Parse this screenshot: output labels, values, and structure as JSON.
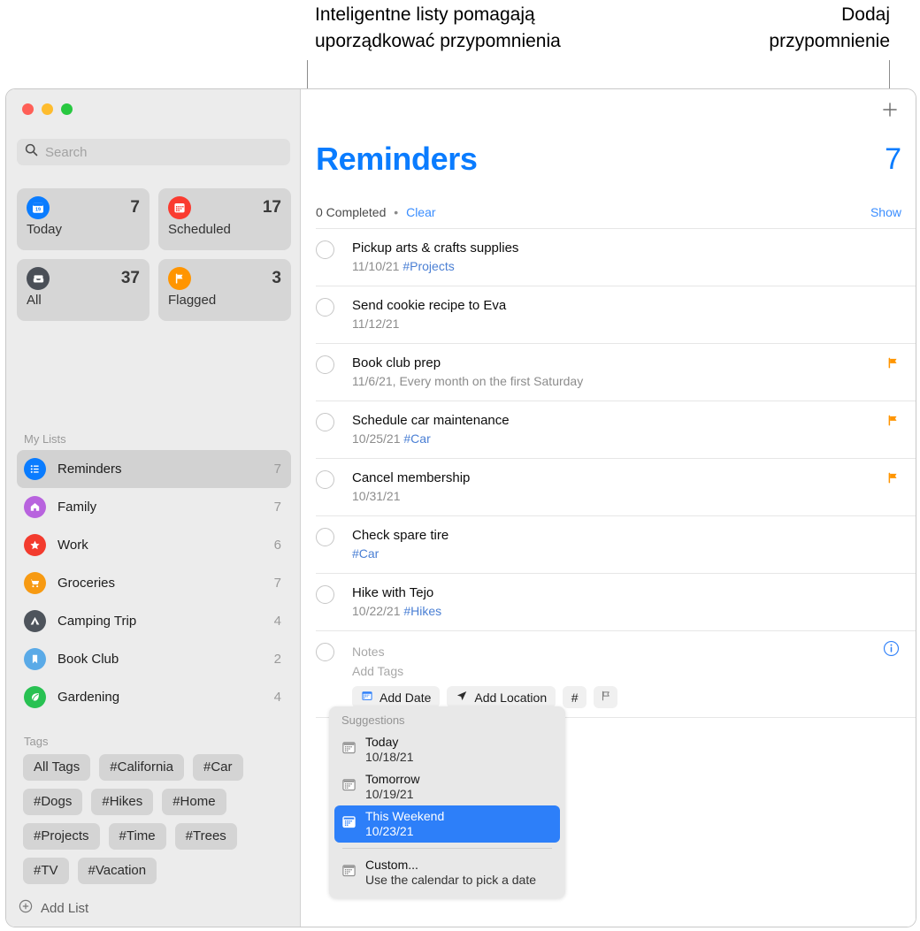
{
  "annotations": {
    "left_callout": "Inteligentne listy pomagają\nuporządkować przypomnienia",
    "right_callout": "Dodaj\nprzypomnienie"
  },
  "window": {
    "traffic_lights": [
      {
        "name": "close",
        "color": "#FF5F57"
      },
      {
        "name": "minimize",
        "color": "#FEBC2E"
      },
      {
        "name": "zoom",
        "color": "#28C840"
      }
    ]
  },
  "sidebar": {
    "search": {
      "placeholder": "Search",
      "icon": "search-icon"
    },
    "smart_lists": [
      {
        "label": "Today",
        "count": "7",
        "icon": "calendar-today-icon",
        "color": "#0a7cff",
        "day": "19"
      },
      {
        "label": "Scheduled",
        "count": "17",
        "icon": "calendar-scheduled-icon",
        "color": "#fa3b30"
      },
      {
        "label": "All",
        "count": "37",
        "icon": "inbox-tray-icon",
        "color": "#4a4f57"
      },
      {
        "label": "Flagged",
        "count": "3",
        "icon": "flag-icon",
        "color": "#ff9500"
      }
    ],
    "my_lists_header": "My Lists",
    "lists": [
      {
        "label": "Reminders",
        "count": "7",
        "icon": "bulleted-list-icon",
        "color": "#0a7cff",
        "selected": true
      },
      {
        "label": "Family",
        "count": "7",
        "icon": "house-icon",
        "color": "#b863de",
        "selected": false
      },
      {
        "label": "Work",
        "count": "6",
        "icon": "star-icon",
        "color": "#f33b2e",
        "selected": false
      },
      {
        "label": "Groceries",
        "count": "7",
        "icon": "shopping-cart-icon",
        "color": "#f79a12",
        "selected": false
      },
      {
        "label": "Camping Trip",
        "count": "4",
        "icon": "tent-icon",
        "color": "#4e545c",
        "selected": false
      },
      {
        "label": "Book Club",
        "count": "2",
        "icon": "bookmark-icon",
        "color": "#5aaae7",
        "selected": false
      },
      {
        "label": "Gardening",
        "count": "4",
        "icon": "leaf-icon",
        "color": "#28c152",
        "selected": false
      }
    ],
    "tags_header": "Tags",
    "tags": [
      "All Tags",
      "#California",
      "#Car",
      "#Dogs",
      "#Hikes",
      "#Home",
      "#Projects",
      "#Time",
      "#Trees",
      "#TV",
      "#Vacation"
    ],
    "add_list": {
      "label": "Add List",
      "icon": "plus-circle-icon"
    }
  },
  "main": {
    "add_button_icon": "plus-icon",
    "title": "Reminders",
    "count": "7",
    "completed_text": "0 Completed",
    "separator": "•",
    "clear_label": "Clear",
    "show_label": "Show",
    "accent_color": "#0a7cff",
    "reminders": [
      {
        "title": "Pickup arts & crafts supplies",
        "date": "11/10/21",
        "tag": "#Projects",
        "flagged": false
      },
      {
        "title": "Send cookie recipe to Eva",
        "date": "11/12/21",
        "tag": "",
        "flagged": false
      },
      {
        "title": "Book club prep",
        "date": "11/6/21, Every month on the first Saturday",
        "tag": "",
        "flagged": true
      },
      {
        "title": "Schedule car maintenance",
        "date": "10/25/21",
        "tag": "#Car",
        "flagged": true
      },
      {
        "title": "Cancel membership",
        "date": "10/31/21",
        "tag": "",
        "flagged": true
      },
      {
        "title": "Check spare tire",
        "date": "",
        "tag": "#Car",
        "flagged": false
      },
      {
        "title": "Hike with Tejo",
        "date": "10/22/21",
        "tag": "#Hikes",
        "flagged": false
      }
    ],
    "new_reminder": {
      "title_value": "",
      "notes_placeholder": "Notes",
      "tags_placeholder": "Add Tags",
      "info_icon": "info-circle-icon",
      "toolbar": [
        {
          "label": "Add Date",
          "icon": "calendar-icon"
        },
        {
          "label": "Add Location",
          "icon": "location-arrow-icon"
        },
        {
          "label": "#",
          "icon": "hash-icon"
        },
        {
          "label": "",
          "icon": "flag-outline-icon"
        }
      ]
    }
  },
  "suggestions": {
    "header": "Suggestions",
    "items": [
      {
        "title": "Today",
        "subtitle": "10/18/21",
        "icon": "calendar-icon",
        "selected": false
      },
      {
        "title": "Tomorrow",
        "subtitle": "10/19/21",
        "icon": "calendar-icon",
        "selected": false
      },
      {
        "title": "This Weekend",
        "subtitle": "10/23/21",
        "icon": "calendar-icon",
        "selected": true
      },
      {
        "title": "Custom...",
        "subtitle": "Use the calendar to pick a date",
        "icon": "calendar-icon",
        "selected": false
      }
    ],
    "highlight_color": "#2d7ff9"
  }
}
